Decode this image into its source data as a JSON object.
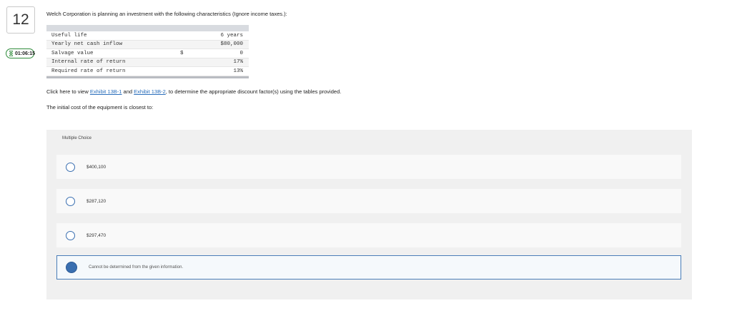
{
  "question": {
    "number": "12",
    "timer": "01:06:15",
    "intro": "Welch Corporation is planning an investment with the following characteristics (Ignore income taxes.):",
    "table": {
      "rows": [
        {
          "label": "Useful life",
          "currency": "",
          "value": "6 years"
        },
        {
          "label": "Yearly net cash inflow",
          "currency": "",
          "value": "$80,000"
        },
        {
          "label": "Salvage value",
          "currency": "$",
          "value": "0"
        },
        {
          "label": "Internal rate of return",
          "currency": "",
          "value": "17%"
        },
        {
          "label": "Required rate of return",
          "currency": "",
          "value": "13%"
        }
      ]
    },
    "instruction": {
      "before": "Click here to view ",
      "link1": "Exhibit 13B-1",
      "between": " and ",
      "link2": "Exhibit 13B-2",
      "after": ", to determine the appropriate discount factor(s) using the tables provided."
    },
    "prompt": "The initial cost of the equipment is closest to:"
  },
  "multiple_choice": {
    "title": "Multiple Choice",
    "options": [
      {
        "label": "$400,100",
        "selected": false
      },
      {
        "label": "$287,120",
        "selected": false
      },
      {
        "label": "$297,470",
        "selected": false
      },
      {
        "label": "Cannot be determined from the given information.",
        "selected": true
      }
    ]
  },
  "colors": {
    "accent": "#3a6fb0",
    "link": "#2a6ebb",
    "timer_border": "#2e8b3a",
    "panel_bg": "#f0f0f0"
  },
  "icons": {
    "timer": "hourglass-icon"
  }
}
